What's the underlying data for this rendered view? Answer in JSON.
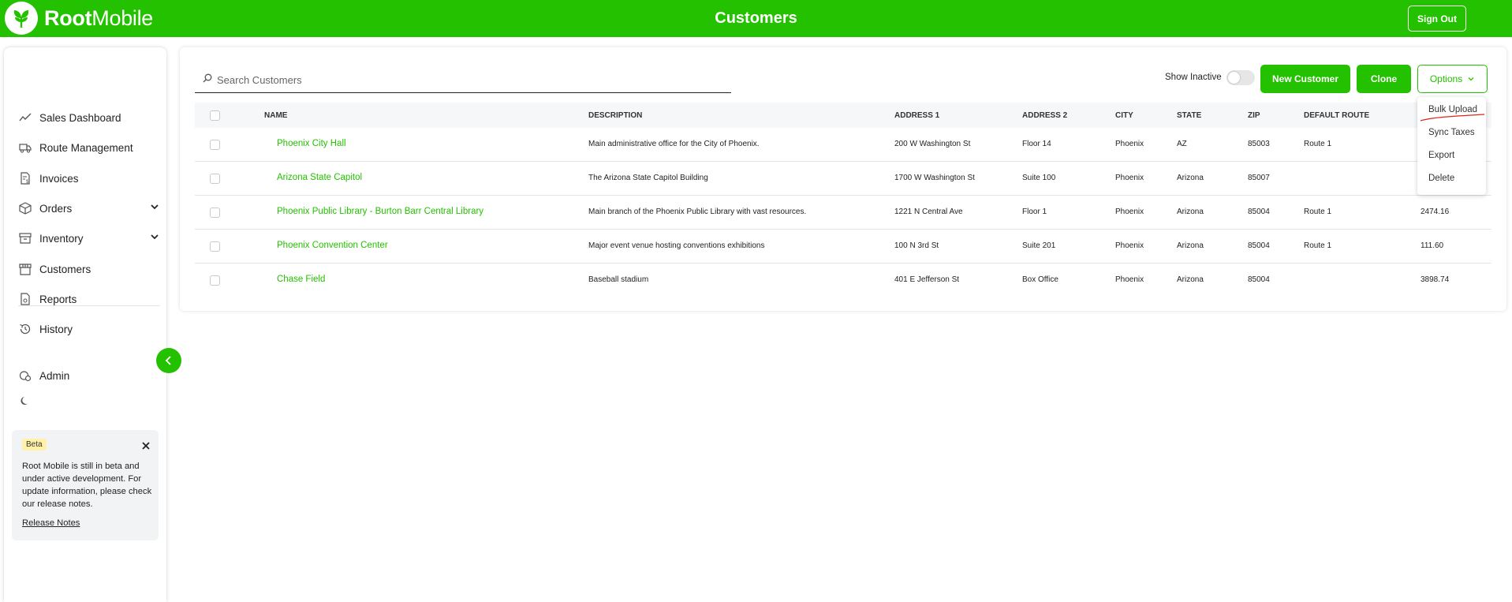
{
  "header": {
    "logo_bold": "Root",
    "logo_light": "Mobile",
    "title": "Customers",
    "sign_out": "Sign Out"
  },
  "sidebar": {
    "items": [
      {
        "label": "Sales Dashboard",
        "icon": "trend-line-icon"
      },
      {
        "label": "Route Management",
        "icon": "truck-icon"
      },
      {
        "label": "Invoices",
        "icon": "invoice-icon"
      },
      {
        "label": "Orders",
        "icon": "box-icon",
        "expandable": true
      },
      {
        "label": "Inventory",
        "icon": "archive-icon",
        "expandable": true
      },
      {
        "label": "Customers",
        "icon": "store-icon"
      },
      {
        "label": "Reports",
        "icon": "report-icon"
      },
      {
        "label": "History",
        "icon": "history-icon"
      }
    ],
    "admin": {
      "label": "Admin",
      "icon": "admin-gear-icon"
    },
    "theme_icon": "moon-icon",
    "beta": {
      "badge": "Beta",
      "text": "Root Mobile is still in beta and under active development. For update information, please check our release notes.",
      "link": "Release Notes"
    }
  },
  "toolbar": {
    "search_placeholder": "Search Customers",
    "show_inactive_label": "Show Inactive",
    "show_inactive_on": false,
    "new_customer": "New Customer",
    "clone": "Clone",
    "options": "Options"
  },
  "options_menu": [
    "Bulk Upload",
    "Sync Taxes",
    "Export",
    "Delete"
  ],
  "table": {
    "columns": [
      "NAME",
      "DESCRIPTION",
      "ADDRESS 1",
      "ADDRESS 2",
      "CITY",
      "STATE",
      "ZIP",
      "DEFAULT ROUTE"
    ],
    "rows": [
      {
        "name": "Phoenix City Hall",
        "description": "Main administrative office for the City of Phoenix.",
        "address1": "200 W Washington St",
        "address2": "Floor 14",
        "city": "Phoenix",
        "state": "AZ",
        "zip": "85003",
        "route": "Route 1",
        "amount": ""
      },
      {
        "name": "Arizona State Capitol",
        "description": "The Arizona State Capitol Building",
        "address1": "1700 W Washington St",
        "address2": "Suite 100",
        "city": "Phoenix",
        "state": "Arizona",
        "zip": "85007",
        "route": "",
        "amount": ""
      },
      {
        "name": "Phoenix Public Library - Burton Barr Central Library",
        "description": "Main branch of the Phoenix Public Library with vast resources.",
        "address1": "1221 N Central Ave",
        "address2": "Floor 1",
        "city": "Phoenix",
        "state": "Arizona",
        "zip": "85004",
        "route": "Route 1",
        "amount": "2474.16"
      },
      {
        "name": "Phoenix Convention Center",
        "description": "Major event venue hosting conventions exhibitions",
        "address1": "100 N 3rd St",
        "address2": "Suite 201",
        "city": "Phoenix",
        "state": "Arizona",
        "zip": "85004",
        "route": "Route 1",
        "amount": "111.60"
      },
      {
        "name": "Chase Field",
        "description": "Baseball stadium",
        "address1": "401 E Jefferson St",
        "address2": "Box Office",
        "city": "Phoenix",
        "state": "Arizona",
        "zip": "85004",
        "route": "",
        "amount": "3898.74"
      }
    ]
  },
  "colors": {
    "brand_green": "#24c100",
    "annotation_red": "#e0251b"
  }
}
